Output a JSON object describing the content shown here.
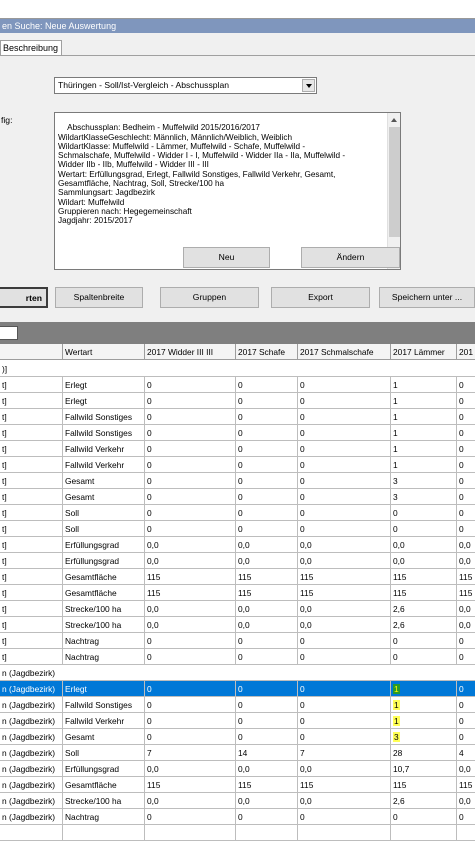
{
  "window": {
    "title": "en Suche: Neue Auswertung"
  },
  "tabs": [
    {
      "label": "Beschreibung"
    }
  ],
  "report_select": {
    "value": "Thüringen - Soll/Ist-Vergleich - Abschussplan"
  },
  "config": {
    "label": "fig:",
    "text": "Abschussplan: Bedheim - Muffelwild 2015/2016/2017\nWildartKlasseGeschlecht: Männlich, Männlich/Weiblich, Weiblich\nWildartKlasse: Muffelwild - Lämmer, Muffelwild - Schafe, Muffelwild -\nSchmalschafe, Muffelwild - Widder I - I, Muffelwild - Widder IIa - IIa, Muffelwild -\nWidder IIb - IIb, Muffelwild - Widder III - III\nWertart: Erfüllungsgrad, Erlegt, Fallwild Sonstiges, Fallwild Verkehr, Gesamt,\nGesamtfläche, Nachtrag, Soll, Strecke/100 ha\nSammlungsart: Jagdbezirk\nWildart: Muffelwild\nGruppieren nach: Hegegemeinschaft\nJagdjahr: 2015/2017"
  },
  "buttons": {
    "neu": "Neu",
    "aendern": "Ändern",
    "sortieren": "rten",
    "spaltenbreite": "Spaltenbreite",
    "gruppen": "Gruppen",
    "export": "Export",
    "speichern": "Speichern unter ..."
  },
  "grid": {
    "columns": [
      "",
      "Wertart",
      "2017 Widder III III",
      "2017 Schafe",
      "2017 Schmalschafe",
      "2017 Lämmer",
      "201"
    ],
    "rows": [
      {
        "type": "group",
        "text": ")]"
      },
      {
        "cells": [
          "t]",
          "Erlegt",
          "0",
          "0",
          "0",
          "1",
          "0"
        ]
      },
      {
        "cells": [
          "t]",
          "Erlegt",
          "0",
          "0",
          "0",
          "1",
          "0"
        ]
      },
      {
        "cells": [
          "t]",
          "Fallwild Sonstiges",
          "0",
          "0",
          "0",
          "1",
          "0"
        ]
      },
      {
        "cells": [
          "t]",
          "Fallwild Sonstiges",
          "0",
          "0",
          "0",
          "1",
          "0"
        ]
      },
      {
        "cells": [
          "t]",
          "Fallwild Verkehr",
          "0",
          "0",
          "0",
          "1",
          "0"
        ]
      },
      {
        "cells": [
          "t]",
          "Fallwild Verkehr",
          "0",
          "0",
          "0",
          "1",
          "0"
        ]
      },
      {
        "cells": [
          "t]",
          "Gesamt",
          "0",
          "0",
          "0",
          "3",
          "0"
        ]
      },
      {
        "cells": [
          "t]",
          "Gesamt",
          "0",
          "0",
          "0",
          "3",
          "0"
        ]
      },
      {
        "cells": [
          "t]",
          "Soll",
          "0",
          "0",
          "0",
          "0",
          "0"
        ]
      },
      {
        "cells": [
          "t]",
          "Soll",
          "0",
          "0",
          "0",
          "0",
          "0"
        ]
      },
      {
        "cells": [
          "t]",
          "Erfüllungsgrad",
          "0,0",
          "0,0",
          "0,0",
          "0,0",
          "0,0"
        ]
      },
      {
        "cells": [
          "t]",
          "Erfüllungsgrad",
          "0,0",
          "0,0",
          "0,0",
          "0,0",
          "0,0"
        ]
      },
      {
        "cells": [
          "t]",
          "Gesamtfläche",
          "115",
          "115",
          "115",
          "115",
          "115"
        ]
      },
      {
        "cells": [
          "t]",
          "Gesamtfläche",
          "115",
          "115",
          "115",
          "115",
          "115"
        ]
      },
      {
        "cells": [
          "t]",
          "Strecke/100 ha",
          "0,0",
          "0,0",
          "0,0",
          "2,6",
          "0,0"
        ]
      },
      {
        "cells": [
          "t]",
          "Strecke/100 ha",
          "0,0",
          "0,0",
          "0,0",
          "2,6",
          "0,0"
        ]
      },
      {
        "cells": [
          "t]",
          "Nachtrag",
          "0",
          "0",
          "0",
          "0",
          "0"
        ]
      },
      {
        "cells": [
          "t]",
          "Nachtrag",
          "0",
          "0",
          "0",
          "0",
          "0"
        ]
      },
      {
        "type": "group",
        "text": "n (Jagdbezirk)"
      },
      {
        "selected": true,
        "mark": "green",
        "cells": [
          "n (Jagdbezirk)",
          "Erlegt",
          "0",
          "0",
          "0",
          "1",
          "0"
        ]
      },
      {
        "mark": "yellow",
        "cells": [
          "n (Jagdbezirk)",
          "Fallwild Sonstiges",
          "0",
          "0",
          "0",
          "1",
          "0"
        ]
      },
      {
        "mark": "yellow",
        "cells": [
          "n (Jagdbezirk)",
          "Fallwild Verkehr",
          "0",
          "0",
          "0",
          "1",
          "0"
        ]
      },
      {
        "mark": "yellow",
        "cells": [
          "n (Jagdbezirk)",
          "Gesamt",
          "0",
          "0",
          "0",
          "3",
          "0"
        ]
      },
      {
        "cells": [
          "n (Jagdbezirk)",
          "Soll",
          "7",
          "14",
          "7",
          "28",
          "4"
        ]
      },
      {
        "cells": [
          "n (Jagdbezirk)",
          "Erfüllungsgrad",
          "0,0",
          "0,0",
          "0,0",
          "10,7",
          "0,0"
        ]
      },
      {
        "cells": [
          "n (Jagdbezirk)",
          "Gesamtfläche",
          "115",
          "115",
          "115",
          "115",
          "115"
        ]
      },
      {
        "cells": [
          "n (Jagdbezirk)",
          "Strecke/100 ha",
          "0,0",
          "0,0",
          "0,0",
          "2,6",
          "0,0"
        ]
      },
      {
        "cells": [
          "n (Jagdbezirk)",
          "Nachtrag",
          "0",
          "0",
          "0",
          "0",
          "0"
        ]
      },
      {
        "cells": [
          "",
          "",
          "",
          "",
          "",
          "",
          ""
        ]
      }
    ]
  },
  "colors": {
    "titlebar": "#7f96bd",
    "selection": "#0078d7",
    "highlight_yellow": "#ffff55",
    "highlight_green": "#2a9a2a"
  }
}
